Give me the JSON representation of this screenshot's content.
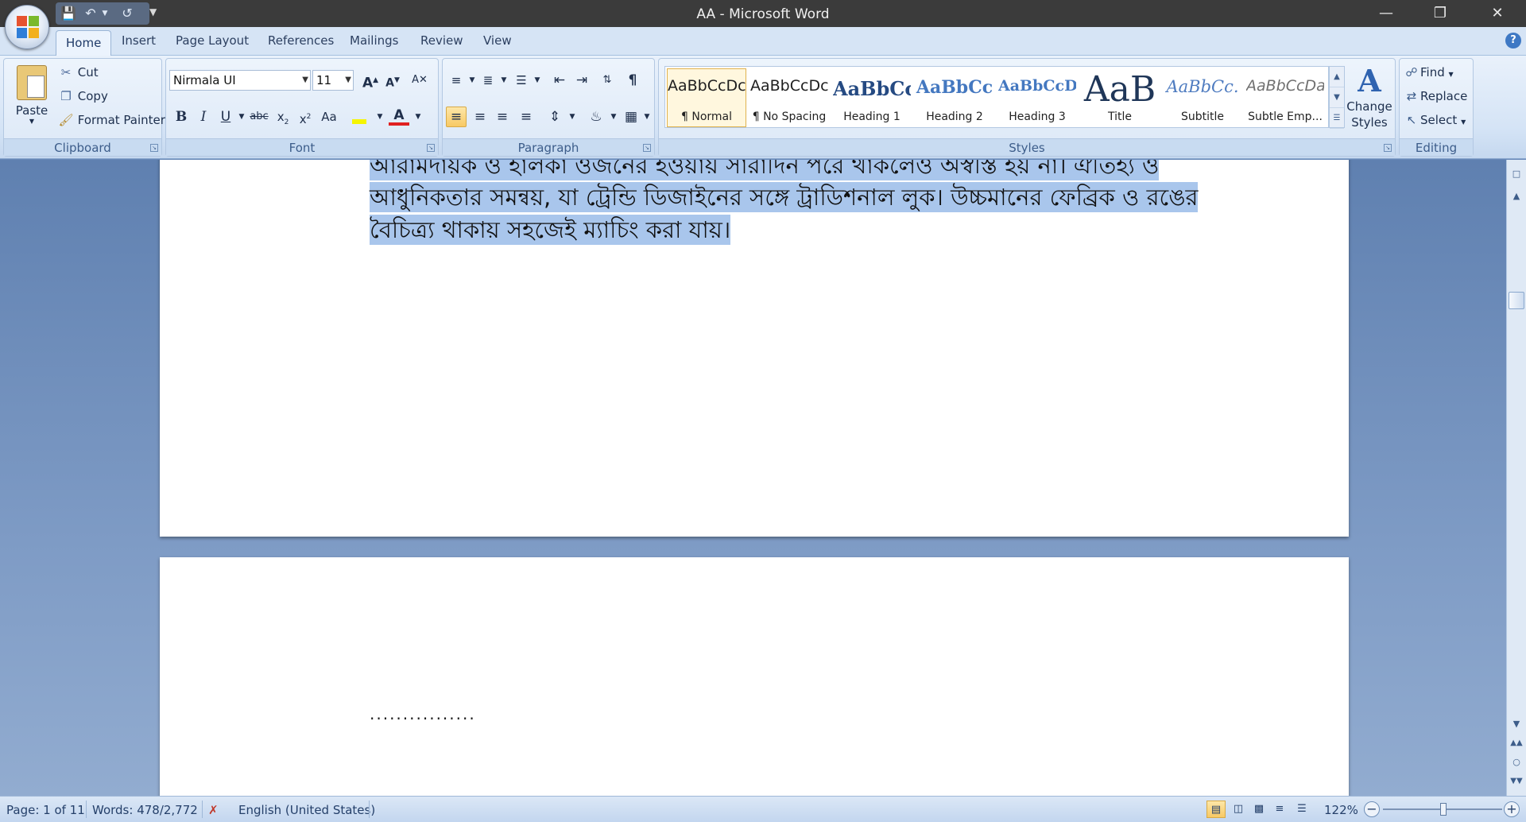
{
  "window": {
    "title": "AA - Microsoft Word"
  },
  "colors": {
    "title_bar": "#3b3b3b",
    "ribbon": "#dce8f7",
    "selection_highlight": "#a9c6ec",
    "workspace": "#6f8fbd"
  },
  "tabs": [
    "Home",
    "Insert",
    "Page Layout",
    "References",
    "Mailings",
    "Review",
    "View"
  ],
  "clipboard": {
    "paste": "Paste",
    "cut": "Cut",
    "copy": "Copy",
    "format_painter": "Format Painter",
    "label": "Clipboard"
  },
  "font": {
    "name": "Nirmala UI",
    "size": "11",
    "label": "Font",
    "icons": [
      "grow-font-icon",
      "shrink-font-icon",
      "clear-formatting-icon",
      "bold-icon",
      "italic-icon",
      "underline-icon",
      "strikethrough-icon",
      "subscript-icon",
      "superscript-icon",
      "change-case-icon",
      "highlight-icon",
      "font-color-icon"
    ]
  },
  "paragraph": {
    "label": "Paragraph"
  },
  "styles": {
    "label": "Styles",
    "items": [
      {
        "sample": "AaBbCcDc",
        "name": "¶ Normal"
      },
      {
        "sample": "AaBbCcDc",
        "name": "¶ No Spacing"
      },
      {
        "sample": "AaBbCc",
        "name": "Heading 1"
      },
      {
        "sample": "AaBbCc",
        "name": "Heading 2"
      },
      {
        "sample": "AaBbCcD",
        "name": "Heading 3"
      },
      {
        "sample": "AaB",
        "name": "Title"
      },
      {
        "sample": "AaBbCc.",
        "name": "Subtitle"
      },
      {
        "sample": "AaBbCcDa",
        "name": "Subtle Emp..."
      }
    ],
    "change_styles": "Change Styles"
  },
  "editing": {
    "find": "Find",
    "replace": "Replace",
    "select": "Select",
    "label": "Editing"
  },
  "document": {
    "lines": [
      "আরামদায়ক ও হালকা ওজনের হওয়ায় সারাদিন পরে থাকলেও অস্বস্তি হয় না। ঐতিহ্য ও",
      "আধুনিকতার সমন্বয়, যা ট্রেন্ডি ডিজাইনের সঙ্গে ট্রাডিশনাল লুক। উচ্চমানের ফেব্রিক ও রঙের",
      "বৈচিত্র্য থাকায় সহজেই ম্যাচিং করা যায়।"
    ],
    "page2_text": "................"
  },
  "status": {
    "page": "Page: 1 of 11",
    "words": "Words: 478/2,772",
    "language": "English (United States)",
    "zoom": "122%"
  }
}
